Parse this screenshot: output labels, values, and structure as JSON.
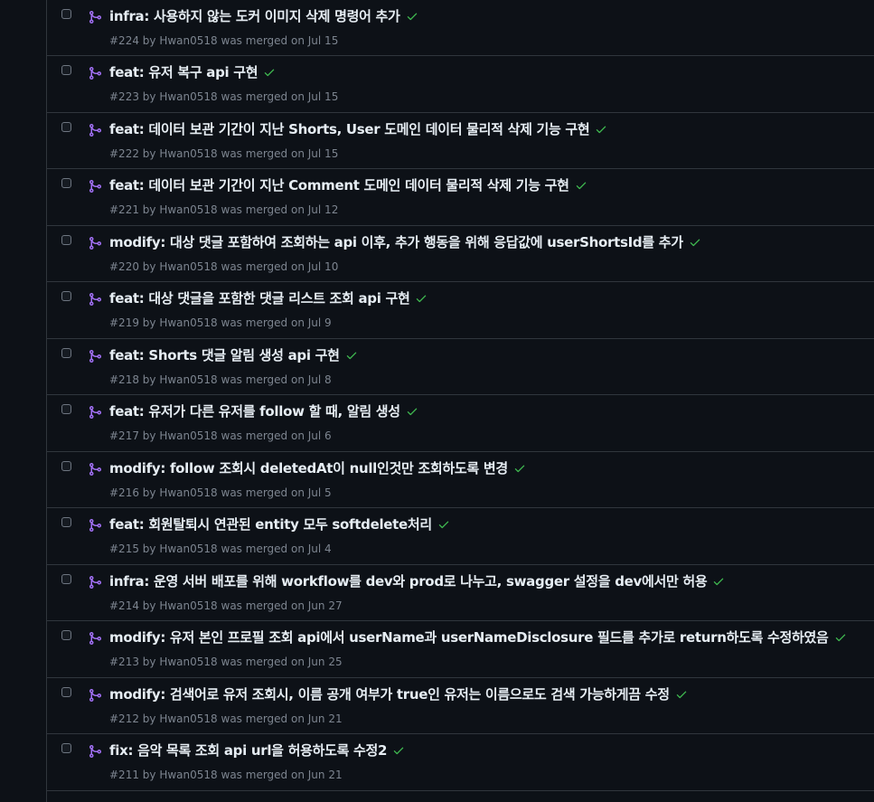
{
  "colors": {
    "background": "#0d1117",
    "border": "#30363d",
    "title": "#e6edf3",
    "meta": "#7d8590",
    "merged_icon": "#a371f7",
    "check": "#3fb950"
  },
  "pull_requests": [
    {
      "title": "infra: 사용하지 않는 도커 이미지 삭제 명령어 추가",
      "number": "#224",
      "by": "by",
      "author": "Hwan0518",
      "merged_text": "was merged on",
      "date": "Jul 15"
    },
    {
      "title": "feat: 유저 복구 api 구현",
      "number": "#223",
      "by": "by",
      "author": "Hwan0518",
      "merged_text": "was merged on",
      "date": "Jul 15"
    },
    {
      "title": "feat: 데이터 보관 기간이 지난 Shorts, User 도메인 데이터 물리적 삭제 기능 구현",
      "number": "#222",
      "by": "by",
      "author": "Hwan0518",
      "merged_text": "was merged on",
      "date": "Jul 15"
    },
    {
      "title": "feat: 데이터 보관 기간이 지난 Comment 도메인 데이터 물리적 삭제 기능 구현",
      "number": "#221",
      "by": "by",
      "author": "Hwan0518",
      "merged_text": "was merged on",
      "date": "Jul 12"
    },
    {
      "title": "modify: 대상 댓글 포함하여 조회하는 api 이후, 추가 행동을 위해 응답값에 userShortsId를 추가",
      "number": "#220",
      "by": "by",
      "author": "Hwan0518",
      "merged_text": "was merged on",
      "date": "Jul 10"
    },
    {
      "title": "feat: 대상 댓글을 포함한 댓글 리스트 조회 api 구현",
      "number": "#219",
      "by": "by",
      "author": "Hwan0518",
      "merged_text": "was merged on",
      "date": "Jul 9"
    },
    {
      "title": "feat: Shorts 댓글 알림 생성 api 구현",
      "number": "#218",
      "by": "by",
      "author": "Hwan0518",
      "merged_text": "was merged on",
      "date": "Jul 8"
    },
    {
      "title": "feat: 유저가 다른 유저를 follow 할 때, 알림 생성",
      "number": "#217",
      "by": "by",
      "author": "Hwan0518",
      "merged_text": "was merged on",
      "date": "Jul 6"
    },
    {
      "title": "modify: follow 조회시 deletedAt이 null인것만 조회하도록 변경",
      "number": "#216",
      "by": "by",
      "author": "Hwan0518",
      "merged_text": "was merged on",
      "date": "Jul 5"
    },
    {
      "title": "feat: 회원탈퇴시 연관된 entity 모두 softdelete처리",
      "number": "#215",
      "by": "by",
      "author": "Hwan0518",
      "merged_text": "was merged on",
      "date": "Jul 4"
    },
    {
      "title": "infra: 운영 서버 배포를 위해 workflow를 dev와 prod로 나누고, swagger 설정을 dev에서만 허용",
      "number": "#214",
      "by": "by",
      "author": "Hwan0518",
      "merged_text": "was merged on",
      "date": "Jun 27"
    },
    {
      "title": "modify: 유저 본인 프로필 조회 api에서 userName과 userNameDisclosure 필드를 추가로 return하도록 수정하였음",
      "number": "#213",
      "by": "by",
      "author": "Hwan0518",
      "merged_text": "was merged on",
      "date": "Jun 25"
    },
    {
      "title": "modify: 검색어로 유저 조회시, 이름 공개 여부가 true인 유저는 이름으로도 검색 가능하게끔 수정",
      "number": "#212",
      "by": "by",
      "author": "Hwan0518",
      "merged_text": "was merged on",
      "date": "Jun 21"
    },
    {
      "title": "fix: 음악 목록 조회 api url을 허용하도록 수정2",
      "number": "#211",
      "by": "by",
      "author": "Hwan0518",
      "merged_text": "was merged on",
      "date": "Jun 21"
    }
  ]
}
